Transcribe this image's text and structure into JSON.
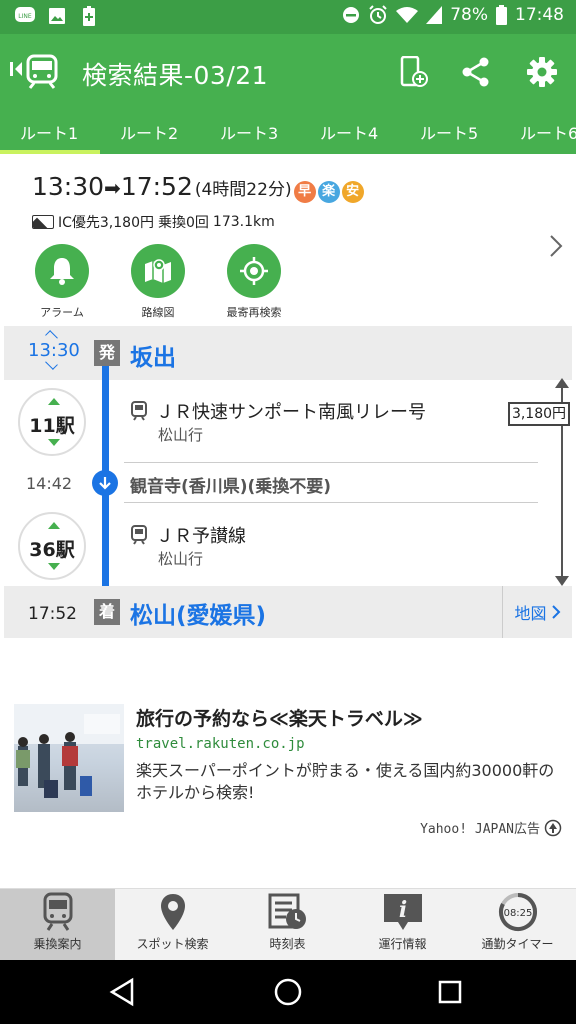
{
  "status_bar": {
    "battery": "78%",
    "time": "17:48",
    "left_icons": [
      "line-icon",
      "image-icon",
      "battery-plus-icon"
    ],
    "right_icons": [
      "do-not-disturb-icon",
      "alarm-icon",
      "wifi-icon",
      "signal-icon",
      "battery-icon"
    ]
  },
  "header": {
    "title": "検索結果-03/21",
    "actions": [
      "add-to-phone-icon",
      "share-icon",
      "settings-icon"
    ]
  },
  "tabs": [
    {
      "label": "ルート1",
      "active": true
    },
    {
      "label": "ルート2"
    },
    {
      "label": "ルート3"
    },
    {
      "label": "ルート4"
    },
    {
      "label": "ルート5"
    },
    {
      "label": "ルート6"
    }
  ],
  "summary": {
    "depart": "13:30",
    "arrow": "➡",
    "arrive": "17:52",
    "duration": "(4時間22分)",
    "badges": [
      {
        "text": "早",
        "color": "#f07c45"
      },
      {
        "text": "楽",
        "color": "#48a7e0"
      },
      {
        "text": "安",
        "color": "#f0a72a"
      }
    ],
    "fare_info": "IC優先3,180円",
    "transfer_info": "乗換0回",
    "distance": "173.1km",
    "buttons": [
      {
        "label": "アラーム",
        "icon": "bell-icon"
      },
      {
        "label": "路線図",
        "icon": "map-icon"
      },
      {
        "label": "最寄再検索",
        "icon": "location-target-icon"
      }
    ]
  },
  "route": {
    "departure": {
      "time": "13:30",
      "kind": "発",
      "station": "坂出"
    },
    "segments": [
      {
        "stops": "11駅",
        "line": "ＪＲ快速サンポート南風リレー号",
        "destination": "松山行"
      },
      {
        "stops": "36駅",
        "line": "ＪＲ予讃線",
        "destination": "松山行"
      }
    ],
    "transfer": {
      "time": "14:42",
      "station": "観音寺(香川県)(乗換不要)"
    },
    "arrival": {
      "time": "17:52",
      "kind": "着",
      "station": "松山(愛媛県)",
      "map_label": "地図"
    },
    "fare": "3,180円"
  },
  "ad": {
    "title": "旅行の予約なら≪楽天トラベル≫",
    "url": "travel.rakuten.co.jp",
    "description": "楽天スーパーポイントが貯まる・使える国内約30000軒のホテルから検索!",
    "label": "Yahoo! JAPAN広告"
  },
  "bottom_nav": [
    {
      "label": "乗換案内",
      "icon": "train-icon",
      "active": true
    },
    {
      "label": "スポット検索",
      "icon": "map-pin-icon"
    },
    {
      "label": "時刻表",
      "icon": "timetable-icon"
    },
    {
      "label": "運行情報",
      "icon": "info-icon"
    },
    {
      "label": "通勤タイマー",
      "icon": "commute-timer-icon",
      "timer_text": "08:25"
    }
  ]
}
